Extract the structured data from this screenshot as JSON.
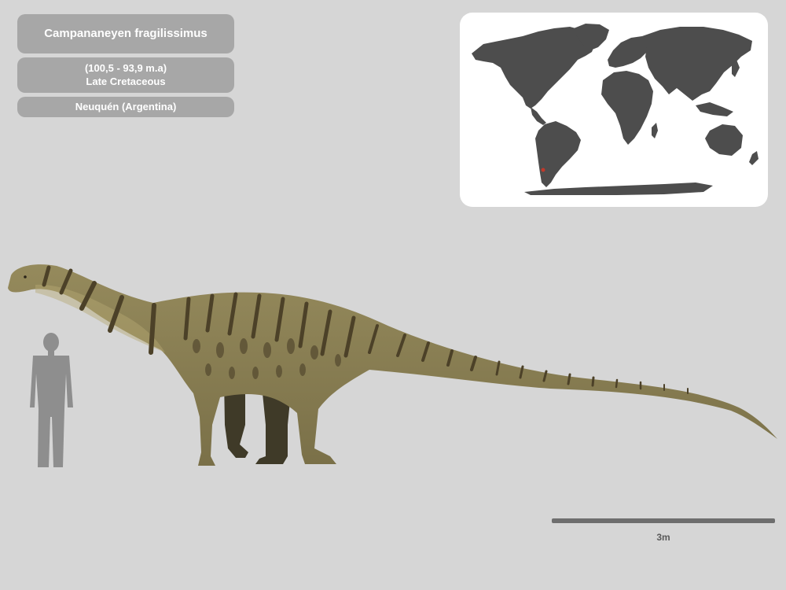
{
  "species": {
    "name": "Campananeyen fragilissimus",
    "age_range": "(100,5 - 93,9 m.a)",
    "epoch": "Late Cretaceous",
    "location": "Neuquén (Argentina)"
  },
  "map": {
    "land_color": "#4d4d4d",
    "ocean_color": "#ffffff",
    "locality_marker_color": "#c0392b"
  },
  "scale": {
    "label": "3m"
  },
  "colors": {
    "background": "#d6d6d6",
    "label_box": "#a7a7a7",
    "silhouette": "#8e8e8e",
    "body": "#8f8458",
    "stripes": "#4c4128"
  }
}
